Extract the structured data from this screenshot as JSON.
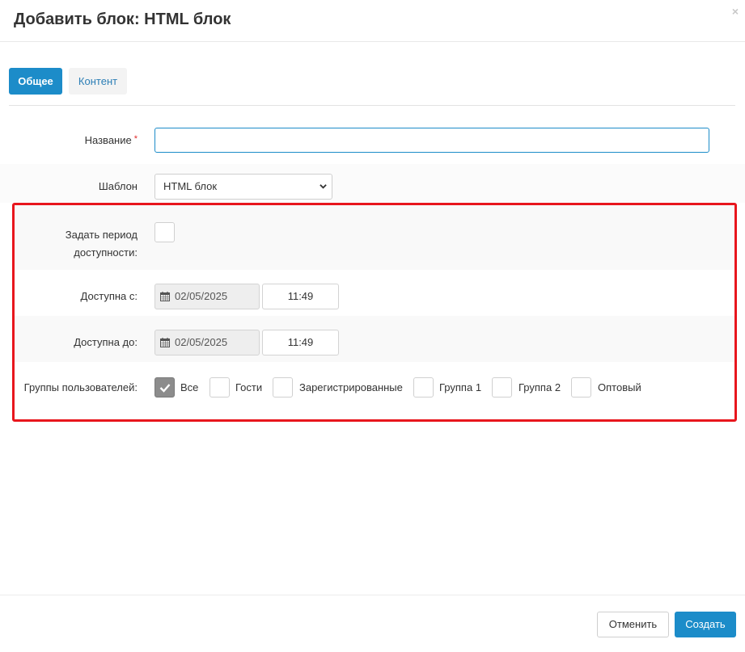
{
  "dialog": {
    "title": "Добавить блок: HTML блок",
    "close_glyph": "×"
  },
  "tabs": [
    {
      "label": "Общее",
      "active": true
    },
    {
      "label": "Контент",
      "active": false
    }
  ],
  "form": {
    "name": {
      "label": "Название",
      "required_mark": "*",
      "value": ""
    },
    "template": {
      "label": "Шаблон",
      "selected": "HTML блок"
    },
    "availability_period": {
      "label_line1": "Задать период",
      "label_line2": "доступности:",
      "checked": false
    },
    "available_from": {
      "label": "Доступна с:",
      "date": "02/05/2025",
      "time": "11:49"
    },
    "available_to": {
      "label": "Доступна до:",
      "date": "02/05/2025",
      "time": "11:49"
    },
    "user_groups": {
      "label": "Группы пользователей:",
      "options": [
        {
          "label": "Все",
          "checked": true
        },
        {
          "label": "Гости",
          "checked": false
        },
        {
          "label": "Зарегистрированные",
          "checked": false
        },
        {
          "label": "Группа 1",
          "checked": false
        },
        {
          "label": "Группа 2",
          "checked": false
        },
        {
          "label": "Оптовый",
          "checked": false
        }
      ]
    }
  },
  "footer": {
    "cancel_label": "Отменить",
    "create_label": "Создать"
  },
  "colors": {
    "accent": "#1c8cc9",
    "highlight_frame": "#e8161d",
    "checked_box": "#8c8c8c"
  }
}
